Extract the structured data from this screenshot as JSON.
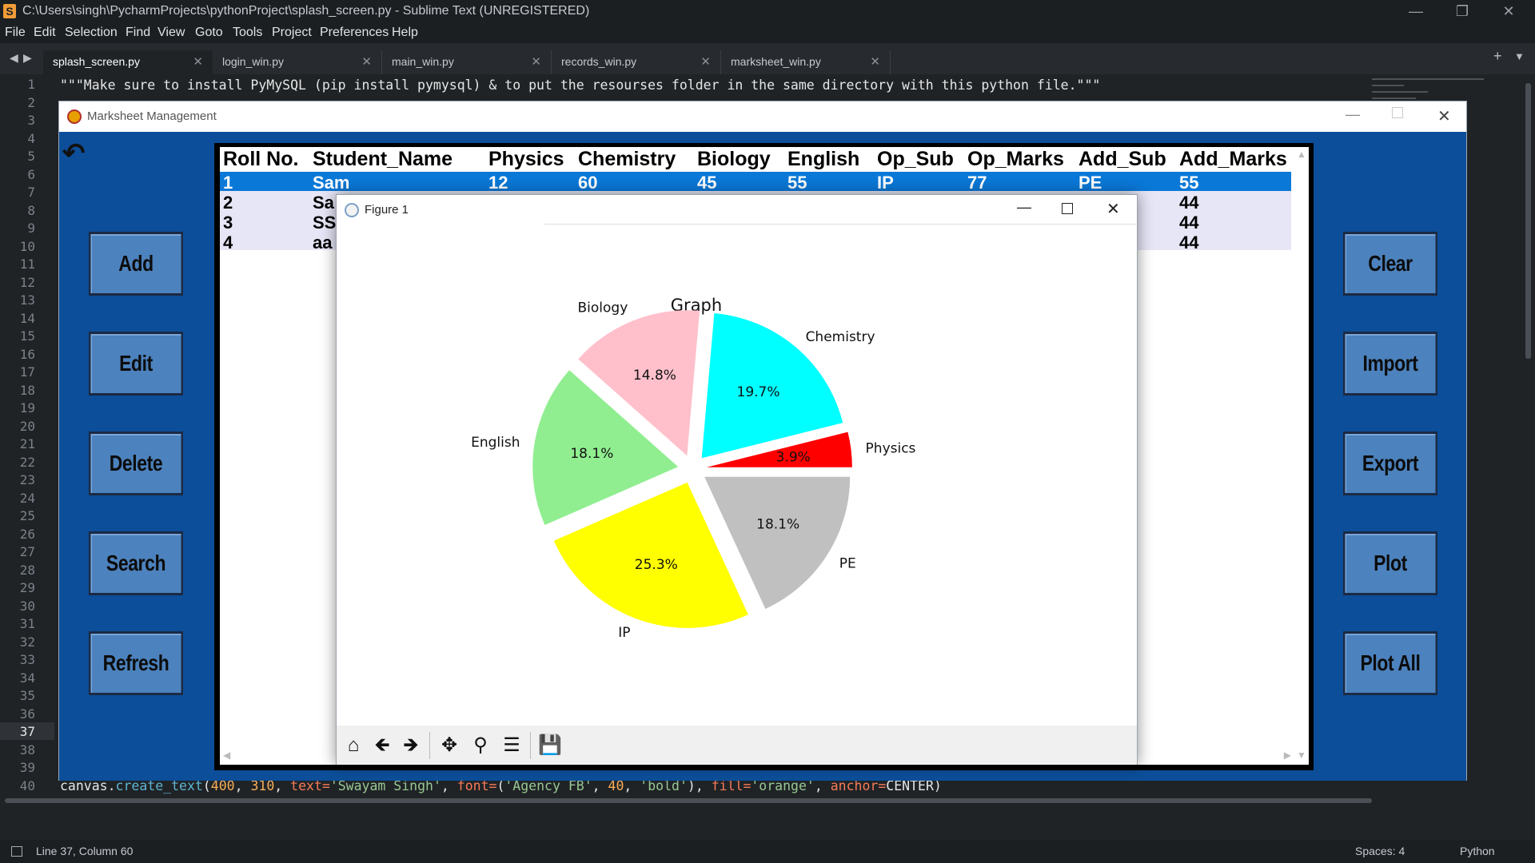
{
  "editor": {
    "title": "C:\\Users\\singh\\PycharmProjects\\pythonProject\\splash_screen.py - Sublime Text (UNREGISTERED)",
    "menu": [
      "File",
      "Edit",
      "Selection",
      "Find",
      "View",
      "Goto",
      "Tools",
      "Project",
      "Preferences",
      "Help"
    ],
    "tabs": [
      "splash_screen.py",
      "login_win.py",
      "main_win.py",
      "records_win.py",
      "marksheet_win.py"
    ],
    "active_tab": 0,
    "line_numbers": [
      "1",
      "2",
      "3",
      "4",
      "5",
      "6",
      "7",
      "8",
      "9",
      "10",
      "11",
      "12",
      "13",
      "14",
      "15",
      "16",
      "17",
      "18",
      "19",
      "20",
      "21",
      "22",
      "23",
      "24",
      "25",
      "26",
      "27",
      "28",
      "29",
      "30",
      "31",
      "32",
      "33",
      "34",
      "35",
      "36",
      "37",
      "38",
      "39",
      "40"
    ],
    "current_line": "37",
    "code_line1": "\"\"\"Make sure to install PyMySQL (pip install pymysql) & to put the resourses folder in the same directory with this python file.\"\"\"",
    "code_line40": {
      "p1": "canvas.",
      "p2": "create_text",
      "p3": "(",
      "p4": "400",
      "p5": ", ",
      "p6": "310",
      "p7": ", ",
      "p8": "text=",
      "p9": "'Swayam Singh'",
      "p10": ", ",
      "p11": "font=",
      "p12": "(",
      "p13": "'Agency FB'",
      "p14": ", ",
      "p15": "40",
      "p16": ", ",
      "p17": "'bold'",
      "p18": "), ",
      "p19": "fill=",
      "p20": "'orange'",
      "p21": ", ",
      "p22": "anchor=",
      "p23": "CENTER)"
    },
    "status": {
      "position": "Line 37, Column 60",
      "spaces": "Spaces: 4",
      "syntax": "Python"
    }
  },
  "app": {
    "title": "Marksheet Management",
    "left_buttons": [
      "Add",
      "Edit",
      "Delete",
      "Search",
      "Refresh"
    ],
    "right_buttons": [
      "Clear",
      "Import",
      "Export",
      "Plot",
      "Plot All"
    ],
    "table": {
      "columns": [
        "Roll No.",
        "Student_Name",
        "Physics",
        "Chemistry",
        "Biology",
        "English",
        "Op_Sub",
        "Op_Marks",
        "Add_Sub",
        "Add_Marks"
      ],
      "rows": [
        [
          "1",
          "Sam",
          "12",
          "60",
          "45",
          "55",
          "IP",
          "77",
          "PE",
          "55"
        ],
        [
          "2",
          "Sa",
          "",
          "",
          "",
          "",
          "",
          "",
          "",
          "44"
        ],
        [
          "3",
          "SS",
          "",
          "",
          "",
          "",
          "",
          "",
          "",
          "44"
        ],
        [
          "4",
          "aa",
          "",
          "",
          "",
          "",
          "",
          "",
          "",
          "44"
        ]
      ]
    }
  },
  "figure": {
    "title": "Figure 1",
    "toolbar": [
      "home-icon",
      "back-arrow-icon",
      "forward-arrow-icon",
      "move-icon",
      "zoom-icon",
      "configure-icon",
      "save-icon"
    ]
  },
  "chart_data": {
    "type": "pie",
    "title": "Graph",
    "categories": [
      "Physics",
      "Chemistry",
      "Biology",
      "English",
      "IP",
      "PE"
    ],
    "values": [
      3.9,
      19.7,
      14.8,
      18.1,
      25.3,
      18.1
    ],
    "labels": [
      "3.9%",
      "19.7%",
      "14.8%",
      "18.1%",
      "25.3%",
      "18.1%"
    ],
    "colors": [
      "#ff0000",
      "#00ffff",
      "#ffc0cb",
      "#90ee90",
      "#ffff00",
      "#c0c0c0"
    ],
    "explode": true
  }
}
